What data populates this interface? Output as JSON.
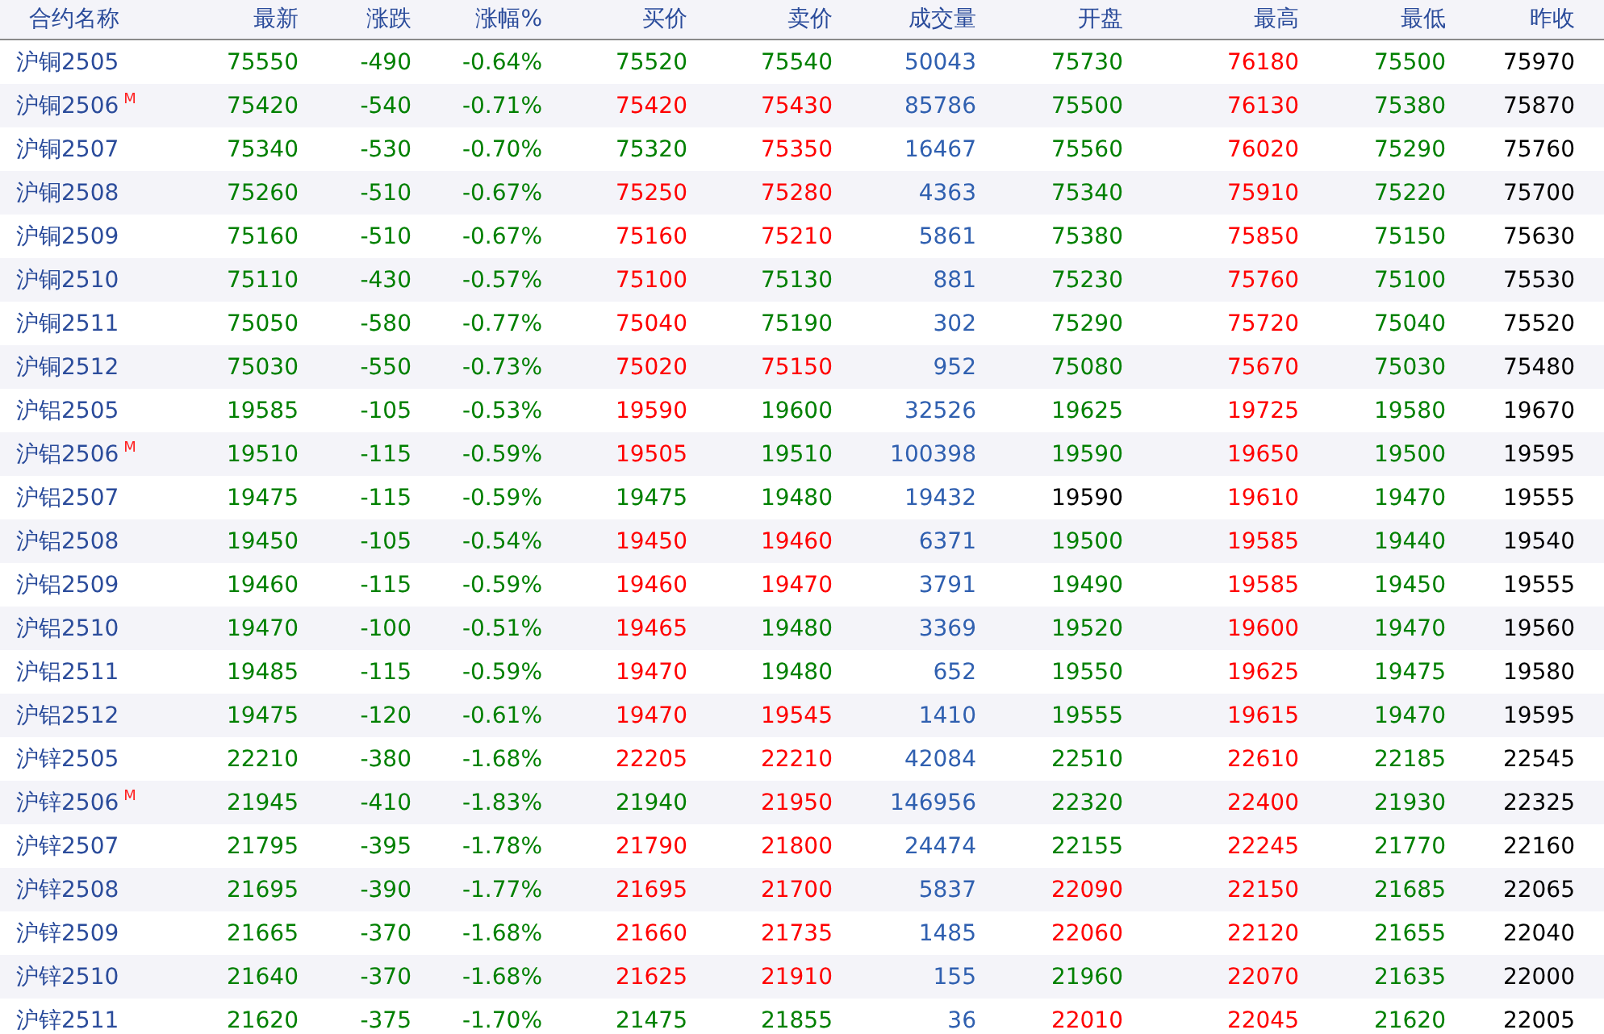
{
  "table": {
    "columns": [
      {
        "label": "合约名称",
        "kind": "name"
      },
      {
        "label": "最新",
        "kind": "price"
      },
      {
        "label": "涨跌",
        "kind": "price"
      },
      {
        "label": "涨幅%",
        "kind": "price"
      },
      {
        "label": "买价",
        "kind": "price"
      },
      {
        "label": "卖价",
        "kind": "price"
      },
      {
        "label": "成交量",
        "kind": "volume"
      },
      {
        "label": "开盘",
        "kind": "price"
      },
      {
        "label": "最高",
        "kind": "price"
      },
      {
        "label": "最低",
        "kind": "price"
      },
      {
        "label": "昨收",
        "kind": "price"
      }
    ],
    "rows": [
      {
        "cells": [
          {
            "text": "沪铜2505"
          },
          {
            "text": "75550",
            "color": "#008000"
          },
          {
            "text": "-490",
            "color": "#008000"
          },
          {
            "text": "-0.64%",
            "color": "#008000"
          },
          {
            "text": "75520",
            "color": "#008000"
          },
          {
            "text": "75540",
            "color": "#008000"
          },
          {
            "text": "50043"
          },
          {
            "text": "75730",
            "color": "#008000"
          },
          {
            "text": "76180",
            "color": "#ff0000"
          },
          {
            "text": "75500",
            "color": "#008000"
          },
          {
            "text": "75970",
            "color": "#000000"
          }
        ]
      },
      {
        "cells": [
          {
            "text": "沪铜2506",
            "badge": "M"
          },
          {
            "text": "75420",
            "color": "#008000"
          },
          {
            "text": "-540",
            "color": "#008000"
          },
          {
            "text": "-0.71%",
            "color": "#008000"
          },
          {
            "text": "75420",
            "color": "#ff0000"
          },
          {
            "text": "75430",
            "color": "#ff0000"
          },
          {
            "text": "85786"
          },
          {
            "text": "75500",
            "color": "#008000"
          },
          {
            "text": "76130",
            "color": "#ff0000"
          },
          {
            "text": "75380",
            "color": "#008000"
          },
          {
            "text": "75870",
            "color": "#000000"
          }
        ]
      },
      {
        "cells": [
          {
            "text": "沪铜2507"
          },
          {
            "text": "75340",
            "color": "#008000"
          },
          {
            "text": "-530",
            "color": "#008000"
          },
          {
            "text": "-0.70%",
            "color": "#008000"
          },
          {
            "text": "75320",
            "color": "#008000"
          },
          {
            "text": "75350",
            "color": "#ff0000"
          },
          {
            "text": "16467"
          },
          {
            "text": "75560",
            "color": "#008000"
          },
          {
            "text": "76020",
            "color": "#ff0000"
          },
          {
            "text": "75290",
            "color": "#008000"
          },
          {
            "text": "75760",
            "color": "#000000"
          }
        ]
      },
      {
        "cells": [
          {
            "text": "沪铜2508"
          },
          {
            "text": "75260",
            "color": "#008000"
          },
          {
            "text": "-510",
            "color": "#008000"
          },
          {
            "text": "-0.67%",
            "color": "#008000"
          },
          {
            "text": "75250",
            "color": "#ff0000"
          },
          {
            "text": "75280",
            "color": "#ff0000"
          },
          {
            "text": "4363"
          },
          {
            "text": "75340",
            "color": "#008000"
          },
          {
            "text": "75910",
            "color": "#ff0000"
          },
          {
            "text": "75220",
            "color": "#008000"
          },
          {
            "text": "75700",
            "color": "#000000"
          }
        ]
      },
      {
        "cells": [
          {
            "text": "沪铜2509"
          },
          {
            "text": "75160",
            "color": "#008000"
          },
          {
            "text": "-510",
            "color": "#008000"
          },
          {
            "text": "-0.67%",
            "color": "#008000"
          },
          {
            "text": "75160",
            "color": "#ff0000"
          },
          {
            "text": "75210",
            "color": "#ff0000"
          },
          {
            "text": "5861"
          },
          {
            "text": "75380",
            "color": "#008000"
          },
          {
            "text": "75850",
            "color": "#ff0000"
          },
          {
            "text": "75150",
            "color": "#008000"
          },
          {
            "text": "75630",
            "color": "#000000"
          }
        ]
      },
      {
        "cells": [
          {
            "text": "沪铜2510"
          },
          {
            "text": "75110",
            "color": "#008000"
          },
          {
            "text": "-430",
            "color": "#008000"
          },
          {
            "text": "-0.57%",
            "color": "#008000"
          },
          {
            "text": "75100",
            "color": "#ff0000"
          },
          {
            "text": "75130",
            "color": "#008000"
          },
          {
            "text": "881"
          },
          {
            "text": "75230",
            "color": "#008000"
          },
          {
            "text": "75760",
            "color": "#ff0000"
          },
          {
            "text": "75100",
            "color": "#008000"
          },
          {
            "text": "75530",
            "color": "#000000"
          }
        ]
      },
      {
        "cells": [
          {
            "text": "沪铜2511"
          },
          {
            "text": "75050",
            "color": "#008000"
          },
          {
            "text": "-580",
            "color": "#008000"
          },
          {
            "text": "-0.77%",
            "color": "#008000"
          },
          {
            "text": "75040",
            "color": "#ff0000"
          },
          {
            "text": "75190",
            "color": "#008000"
          },
          {
            "text": "302"
          },
          {
            "text": "75290",
            "color": "#008000"
          },
          {
            "text": "75720",
            "color": "#ff0000"
          },
          {
            "text": "75040",
            "color": "#008000"
          },
          {
            "text": "75520",
            "color": "#000000"
          }
        ]
      },
      {
        "cells": [
          {
            "text": "沪铜2512"
          },
          {
            "text": "75030",
            "color": "#008000"
          },
          {
            "text": "-550",
            "color": "#008000"
          },
          {
            "text": "-0.73%",
            "color": "#008000"
          },
          {
            "text": "75020",
            "color": "#ff0000"
          },
          {
            "text": "75150",
            "color": "#ff0000"
          },
          {
            "text": "952"
          },
          {
            "text": "75080",
            "color": "#008000"
          },
          {
            "text": "75670",
            "color": "#ff0000"
          },
          {
            "text": "75030",
            "color": "#008000"
          },
          {
            "text": "75480",
            "color": "#000000"
          }
        ]
      },
      {
        "cells": [
          {
            "text": "沪铝2505"
          },
          {
            "text": "19585",
            "color": "#008000"
          },
          {
            "text": "-105",
            "color": "#008000"
          },
          {
            "text": "-0.53%",
            "color": "#008000"
          },
          {
            "text": "19590",
            "color": "#ff0000"
          },
          {
            "text": "19600",
            "color": "#008000"
          },
          {
            "text": "32526"
          },
          {
            "text": "19625",
            "color": "#008000"
          },
          {
            "text": "19725",
            "color": "#ff0000"
          },
          {
            "text": "19580",
            "color": "#008000"
          },
          {
            "text": "19670",
            "color": "#000000"
          }
        ]
      },
      {
        "cells": [
          {
            "text": "沪铝2506",
            "badge": "M"
          },
          {
            "text": "19510",
            "color": "#008000"
          },
          {
            "text": "-115",
            "color": "#008000"
          },
          {
            "text": "-0.59%",
            "color": "#008000"
          },
          {
            "text": "19505",
            "color": "#ff0000"
          },
          {
            "text": "19510",
            "color": "#008000"
          },
          {
            "text": "100398"
          },
          {
            "text": "19590",
            "color": "#008000"
          },
          {
            "text": "19650",
            "color": "#ff0000"
          },
          {
            "text": "19500",
            "color": "#008000"
          },
          {
            "text": "19595",
            "color": "#000000"
          }
        ]
      },
      {
        "cells": [
          {
            "text": "沪铝2507"
          },
          {
            "text": "19475",
            "color": "#008000"
          },
          {
            "text": "-115",
            "color": "#008000"
          },
          {
            "text": "-0.59%",
            "color": "#008000"
          },
          {
            "text": "19475",
            "color": "#008000"
          },
          {
            "text": "19480",
            "color": "#008000"
          },
          {
            "text": "19432"
          },
          {
            "text": "19590",
            "color": "#000000"
          },
          {
            "text": "19610",
            "color": "#ff0000"
          },
          {
            "text": "19470",
            "color": "#008000"
          },
          {
            "text": "19555",
            "color": "#000000"
          }
        ]
      },
      {
        "cells": [
          {
            "text": "沪铝2508"
          },
          {
            "text": "19450",
            "color": "#008000"
          },
          {
            "text": "-105",
            "color": "#008000"
          },
          {
            "text": "-0.54%",
            "color": "#008000"
          },
          {
            "text": "19450",
            "color": "#ff0000"
          },
          {
            "text": "19460",
            "color": "#ff0000"
          },
          {
            "text": "6371"
          },
          {
            "text": "19500",
            "color": "#008000"
          },
          {
            "text": "19585",
            "color": "#ff0000"
          },
          {
            "text": "19440",
            "color": "#008000"
          },
          {
            "text": "19540",
            "color": "#000000"
          }
        ]
      },
      {
        "cells": [
          {
            "text": "沪铝2509"
          },
          {
            "text": "19460",
            "color": "#008000"
          },
          {
            "text": "-115",
            "color": "#008000"
          },
          {
            "text": "-0.59%",
            "color": "#008000"
          },
          {
            "text": "19460",
            "color": "#ff0000"
          },
          {
            "text": "19470",
            "color": "#ff0000"
          },
          {
            "text": "3791"
          },
          {
            "text": "19490",
            "color": "#008000"
          },
          {
            "text": "19585",
            "color": "#ff0000"
          },
          {
            "text": "19450",
            "color": "#008000"
          },
          {
            "text": "19555",
            "color": "#000000"
          }
        ]
      },
      {
        "cells": [
          {
            "text": "沪铝2510"
          },
          {
            "text": "19470",
            "color": "#008000"
          },
          {
            "text": "-100",
            "color": "#008000"
          },
          {
            "text": "-0.51%",
            "color": "#008000"
          },
          {
            "text": "19465",
            "color": "#ff0000"
          },
          {
            "text": "19480",
            "color": "#008000"
          },
          {
            "text": "3369"
          },
          {
            "text": "19520",
            "color": "#008000"
          },
          {
            "text": "19600",
            "color": "#ff0000"
          },
          {
            "text": "19470",
            "color": "#008000"
          },
          {
            "text": "19560",
            "color": "#000000"
          }
        ]
      },
      {
        "cells": [
          {
            "text": "沪铝2511"
          },
          {
            "text": "19485",
            "color": "#008000"
          },
          {
            "text": "-115",
            "color": "#008000"
          },
          {
            "text": "-0.59%",
            "color": "#008000"
          },
          {
            "text": "19470",
            "color": "#ff0000"
          },
          {
            "text": "19480",
            "color": "#008000"
          },
          {
            "text": "652"
          },
          {
            "text": "19550",
            "color": "#008000"
          },
          {
            "text": "19625",
            "color": "#ff0000"
          },
          {
            "text": "19475",
            "color": "#008000"
          },
          {
            "text": "19580",
            "color": "#000000"
          }
        ]
      },
      {
        "cells": [
          {
            "text": "沪铝2512"
          },
          {
            "text": "19475",
            "color": "#008000"
          },
          {
            "text": "-120",
            "color": "#008000"
          },
          {
            "text": "-0.61%",
            "color": "#008000"
          },
          {
            "text": "19470",
            "color": "#ff0000"
          },
          {
            "text": "19545",
            "color": "#ff0000"
          },
          {
            "text": "1410"
          },
          {
            "text": "19555",
            "color": "#008000"
          },
          {
            "text": "19615",
            "color": "#ff0000"
          },
          {
            "text": "19470",
            "color": "#008000"
          },
          {
            "text": "19595",
            "color": "#000000"
          }
        ]
      },
      {
        "cells": [
          {
            "text": "沪锌2505"
          },
          {
            "text": "22210",
            "color": "#008000"
          },
          {
            "text": "-380",
            "color": "#008000"
          },
          {
            "text": "-1.68%",
            "color": "#008000"
          },
          {
            "text": "22205",
            "color": "#ff0000"
          },
          {
            "text": "22210",
            "color": "#ff0000"
          },
          {
            "text": "42084"
          },
          {
            "text": "22510",
            "color": "#008000"
          },
          {
            "text": "22610",
            "color": "#ff0000"
          },
          {
            "text": "22185",
            "color": "#008000"
          },
          {
            "text": "22545",
            "color": "#000000"
          }
        ]
      },
      {
        "cells": [
          {
            "text": "沪锌2506",
            "badge": "M"
          },
          {
            "text": "21945",
            "color": "#008000"
          },
          {
            "text": "-410",
            "color": "#008000"
          },
          {
            "text": "-1.83%",
            "color": "#008000"
          },
          {
            "text": "21940",
            "color": "#008000"
          },
          {
            "text": "21950",
            "color": "#ff0000"
          },
          {
            "text": "146956"
          },
          {
            "text": "22320",
            "color": "#008000"
          },
          {
            "text": "22400",
            "color": "#ff0000"
          },
          {
            "text": "21930",
            "color": "#008000"
          },
          {
            "text": "22325",
            "color": "#000000"
          }
        ]
      },
      {
        "cells": [
          {
            "text": "沪锌2507"
          },
          {
            "text": "21795",
            "color": "#008000"
          },
          {
            "text": "-395",
            "color": "#008000"
          },
          {
            "text": "-1.78%",
            "color": "#008000"
          },
          {
            "text": "21790",
            "color": "#ff0000"
          },
          {
            "text": "21800",
            "color": "#ff0000"
          },
          {
            "text": "24474"
          },
          {
            "text": "22155",
            "color": "#008000"
          },
          {
            "text": "22245",
            "color": "#ff0000"
          },
          {
            "text": "21770",
            "color": "#008000"
          },
          {
            "text": "22160",
            "color": "#000000"
          }
        ]
      },
      {
        "cells": [
          {
            "text": "沪锌2508"
          },
          {
            "text": "21695",
            "color": "#008000"
          },
          {
            "text": "-390",
            "color": "#008000"
          },
          {
            "text": "-1.77%",
            "color": "#008000"
          },
          {
            "text": "21695",
            "color": "#ff0000"
          },
          {
            "text": "21700",
            "color": "#ff0000"
          },
          {
            "text": "5837"
          },
          {
            "text": "22090",
            "color": "#ff0000"
          },
          {
            "text": "22150",
            "color": "#ff0000"
          },
          {
            "text": "21685",
            "color": "#008000"
          },
          {
            "text": "22065",
            "color": "#000000"
          }
        ]
      },
      {
        "cells": [
          {
            "text": "沪锌2509"
          },
          {
            "text": "21665",
            "color": "#008000"
          },
          {
            "text": "-370",
            "color": "#008000"
          },
          {
            "text": "-1.68%",
            "color": "#008000"
          },
          {
            "text": "21660",
            "color": "#ff0000"
          },
          {
            "text": "21735",
            "color": "#ff0000"
          },
          {
            "text": "1485"
          },
          {
            "text": "22060",
            "color": "#ff0000"
          },
          {
            "text": "22120",
            "color": "#ff0000"
          },
          {
            "text": "21655",
            "color": "#008000"
          },
          {
            "text": "22040",
            "color": "#000000"
          }
        ]
      },
      {
        "cells": [
          {
            "text": "沪锌2510"
          },
          {
            "text": "21640",
            "color": "#008000"
          },
          {
            "text": "-370",
            "color": "#008000"
          },
          {
            "text": "-1.68%",
            "color": "#008000"
          },
          {
            "text": "21625",
            "color": "#ff0000"
          },
          {
            "text": "21910",
            "color": "#ff0000"
          },
          {
            "text": "155"
          },
          {
            "text": "21960",
            "color": "#008000"
          },
          {
            "text": "22070",
            "color": "#ff0000"
          },
          {
            "text": "21635",
            "color": "#008000"
          },
          {
            "text": "22000",
            "color": "#000000"
          }
        ]
      },
      {
        "cells": [
          {
            "text": "沪锌2511"
          },
          {
            "text": "21620",
            "color": "#008000"
          },
          {
            "text": "-375",
            "color": "#008000"
          },
          {
            "text": "-1.70%",
            "color": "#008000"
          },
          {
            "text": "21475",
            "color": "#008000"
          },
          {
            "text": "21855",
            "color": "#008000"
          },
          {
            "text": "36"
          },
          {
            "text": "22010",
            "color": "#ff0000"
          },
          {
            "text": "22045",
            "color": "#ff0000"
          },
          {
            "text": "21620",
            "color": "#008000"
          },
          {
            "text": "22005",
            "color": "#000000"
          }
        ]
      }
    ]
  }
}
